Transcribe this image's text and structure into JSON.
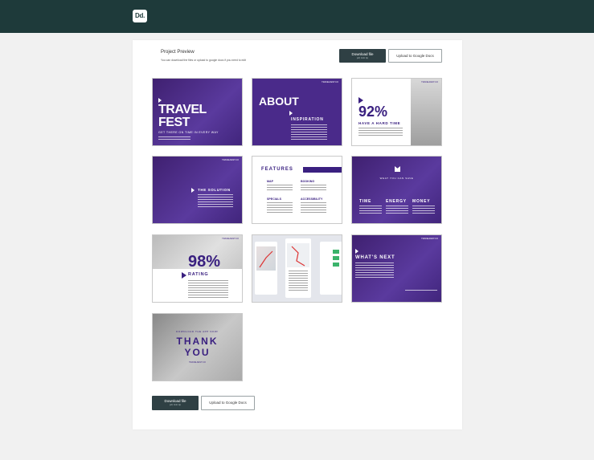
{
  "app": {
    "logo": "Dd."
  },
  "header": {
    "title": "Project Preview",
    "subtitle": "You can download the files or upload to google docs if you need to edit"
  },
  "actions": {
    "download_label": "Download file",
    "download_size": "pdf, 4mb zip",
    "upload_label": "Upload to Google Docs"
  },
  "slides": {
    "s1": {
      "kicker": "",
      "title_a": "TRAVEL",
      "title_b": "FEST",
      "tagline": "GET THERE ON TIME IN EVERY WAY"
    },
    "s2": {
      "title": "ABOUT",
      "sub": "INSPIRATION",
      "brand": "TRAVELFEST.CO"
    },
    "s3": {
      "big": "92%",
      "sub": "HAVE A HARD TIME",
      "brand": "TRAVELFEST.CO"
    },
    "s4": {
      "sub": "THE SOLUTION",
      "brand": "TRAVELFEST.CO"
    },
    "s5": {
      "title": "FEATURES",
      "c1": "MAP",
      "c2": "BOOKING",
      "c3": "SPECIALS",
      "c4": "ACCESSIBILITY"
    },
    "s6": {
      "top": "WHAT YOU CAN SAVE",
      "c1": "TIME",
      "c2": "ENERGY",
      "c3": "MONEY"
    },
    "s7": {
      "big": "98%",
      "sub": "RATING",
      "brand": "TRAVELFEST.CO"
    },
    "s9": {
      "title": "WHAT'S NEXT",
      "brand": "TRAVELFEST.CO"
    },
    "s10": {
      "top": "DOWNLOAD THE APP NOW!",
      "a": "THANK",
      "b": "YOU",
      "brand": "TRAVELFEST.CO"
    }
  }
}
